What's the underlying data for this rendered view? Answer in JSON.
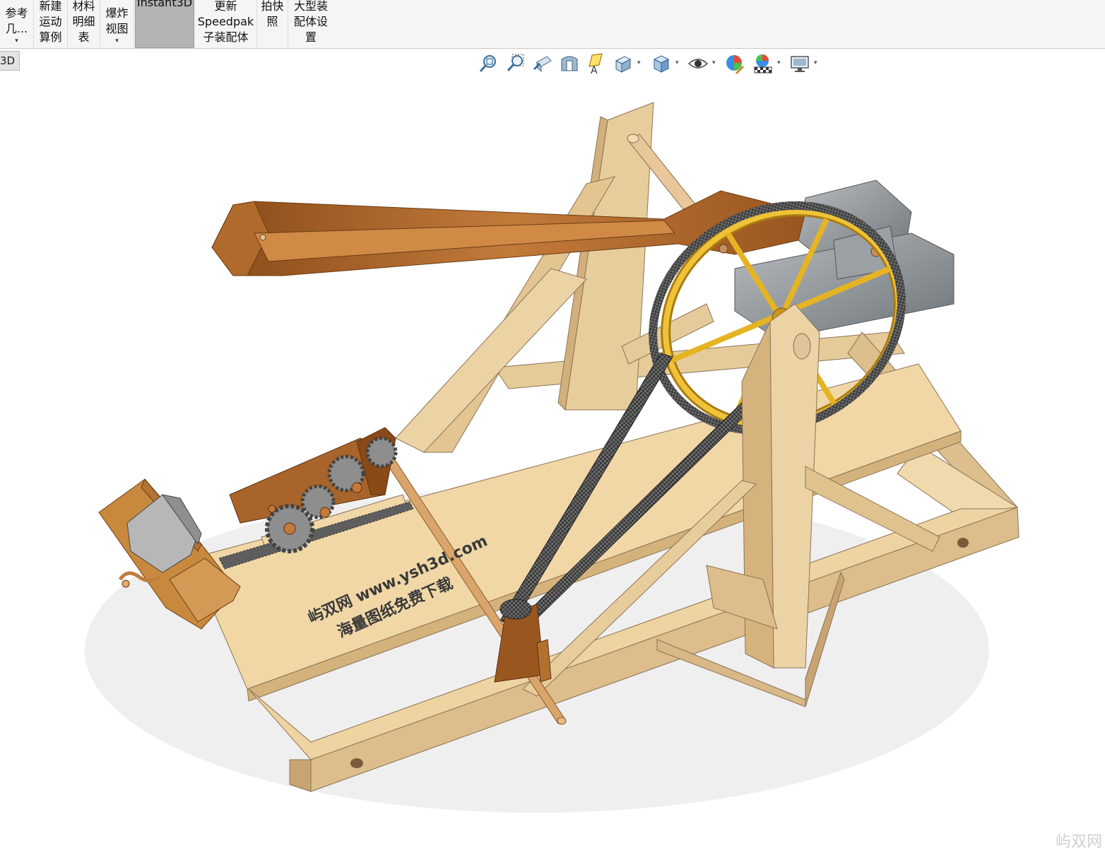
{
  "ribbon": {
    "buttons": [
      {
        "id": "ref-geometry",
        "lines": [
          "参考",
          "几..."
        ],
        "dropdown": true
      },
      {
        "id": "new-motion-study",
        "lines": [
          "新建",
          "运动",
          "算例"
        ],
        "dropdown": false
      },
      {
        "id": "bom",
        "lines": [
          "材料",
          "明细",
          "表"
        ],
        "dropdown": false
      },
      {
        "id": "exploded-view",
        "lines": [
          "爆炸",
          "视图"
        ],
        "dropdown": true
      },
      {
        "id": "instant3d",
        "lines": [
          "Instant3D"
        ],
        "dropdown": false,
        "active": true
      },
      {
        "id": "update-speedpak",
        "lines": [
          "更新",
          "Speedpak",
          "子装配体"
        ],
        "dropdown": false
      },
      {
        "id": "snapshot",
        "lines": [
          "拍快",
          "照"
        ],
        "dropdown": false
      },
      {
        "id": "large-assembly",
        "lines": [
          "大型装",
          "配体设",
          "置"
        ],
        "dropdown": false
      }
    ],
    "dropdown_glyph": "▾"
  },
  "tabs": {
    "active": "3D"
  },
  "view_toolbar": [
    {
      "name": "zoom-to-fit-icon",
      "dropdown": false
    },
    {
      "name": "zoom-to-area-icon",
      "dropdown": false
    },
    {
      "name": "previous-view-icon",
      "dropdown": false
    },
    {
      "name": "section-view-icon",
      "dropdown": false
    },
    {
      "name": "dynamic-annotation-icon",
      "dropdown": false
    },
    {
      "name": "view-orientation-icon",
      "dropdown": true
    },
    {
      "name": "display-style-icon",
      "dropdown": true
    },
    {
      "name": "hide-show-items-icon",
      "dropdown": true
    },
    {
      "name": "edit-appearance-icon",
      "dropdown": false
    },
    {
      "name": "apply-scene-icon",
      "dropdown": true
    },
    {
      "name": "view-settings-icon",
      "dropdown": true
    }
  ],
  "model": {
    "watermark_line1": "屿双网 www.ysh3d.com",
    "watermark_line2": "海量图纸免费下载"
  },
  "corner_watermark": "屿双网",
  "colors": {
    "ribbon_bg": "#f5f5f5",
    "active_button": "#b3b3b3",
    "wood_light": "#ecd3a6",
    "wood_dark": "#a8642a",
    "gold": "#e6b422",
    "stone": "#8e9499"
  }
}
